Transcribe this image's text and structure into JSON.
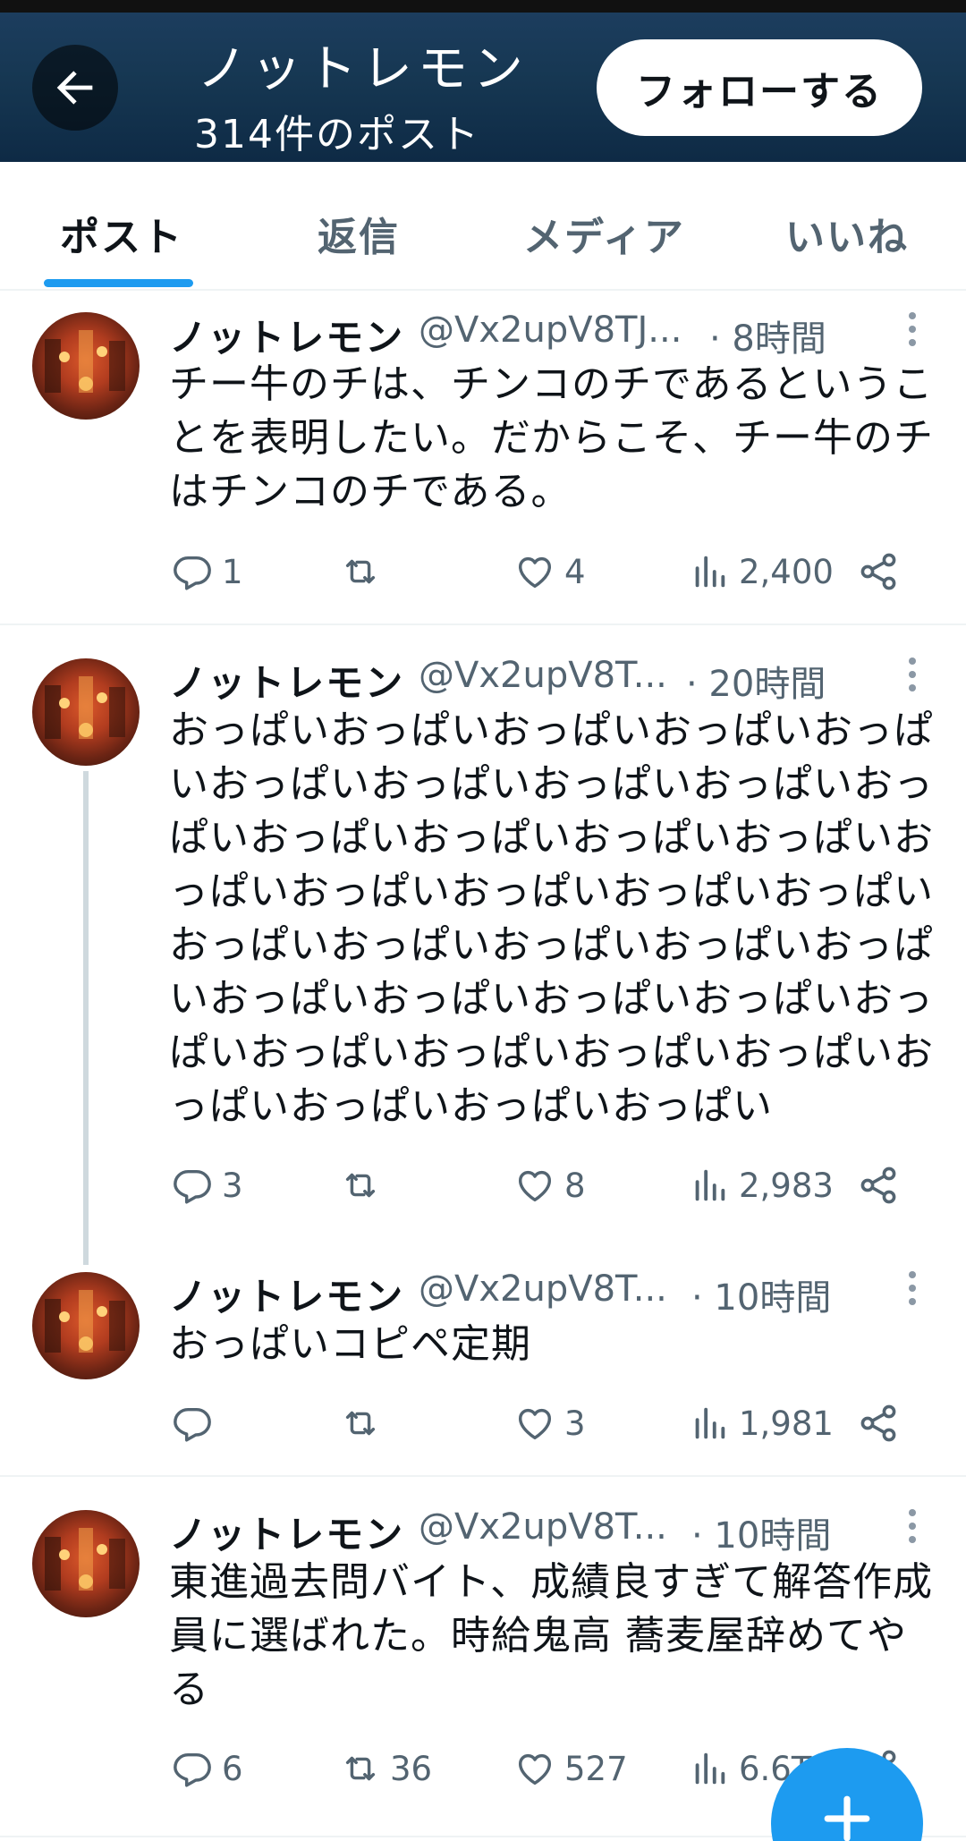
{
  "header": {
    "name": "ノットレモン",
    "post_count": "314件のポスト",
    "follow_label": "フォローする"
  },
  "tabs": [
    {
      "label": "ポスト",
      "active": true
    },
    {
      "label": "返信",
      "active": false
    },
    {
      "label": "メディア",
      "active": false
    },
    {
      "label": "いいね",
      "active": false
    }
  ],
  "colors": {
    "accent": "#1d9bf0",
    "header_bg": "#163752",
    "muted_text": "#536471"
  },
  "icons": {
    "back": "arrow-left-icon",
    "more": "more-vertical-icon",
    "reply": "reply-icon",
    "retweet": "retweet-icon",
    "like": "heart-icon",
    "views": "views-icon",
    "share": "share-icon",
    "compose": "plus-icon"
  },
  "tweets": [
    {
      "name": "ノットレモン",
      "handle": "@Vx2upV8TJ...",
      "time": "· 8時間",
      "text": "チー牛のチは、チンコのチであるということを表明したい。だからこそ、チー牛のチはチンコのチである。",
      "replies": "1",
      "retweets": "",
      "likes": "4",
      "views": "2,400"
    },
    {
      "name": "ノットレモン",
      "handle": "@Vx2upV8T...",
      "time": "· 20時間",
      "text": "おっぱいおっぱいおっぱいおっぱいおっぱいおっぱいおっぱいおっぱいおっぱいおっぱいおっぱいおっぱいおっぱいおっぱいおっぱいおっぱいおっぱいおっぱいおっぱいおっぱいおっぱいおっぱいおっぱいおっぱいおっぱいおっぱいおっぱいおっぱいおっぱいおっぱいおっぱいおっぱいおっぱいおっぱいおっぱいおっぱいおっぱい",
      "replies": "3",
      "retweets": "",
      "likes": "8",
      "views": "2,983"
    },
    {
      "name": "ノットレモン",
      "handle": "@Vx2upV8T...",
      "time": "· 10時間",
      "text": "おっぱいコピペ定期",
      "replies": "",
      "retweets": "",
      "likes": "3",
      "views": "1,981"
    },
    {
      "name": "ノットレモン",
      "handle": "@Vx2upV8T...",
      "time": "· 10時間",
      "text": "東進過去問バイト、成績良すぎて解答作成員に選ばれた。時給鬼高 蕎麦屋辞めてやる",
      "replies": "6",
      "retweets": "36",
      "likes": "527",
      "views": "6.6T"
    }
  ]
}
